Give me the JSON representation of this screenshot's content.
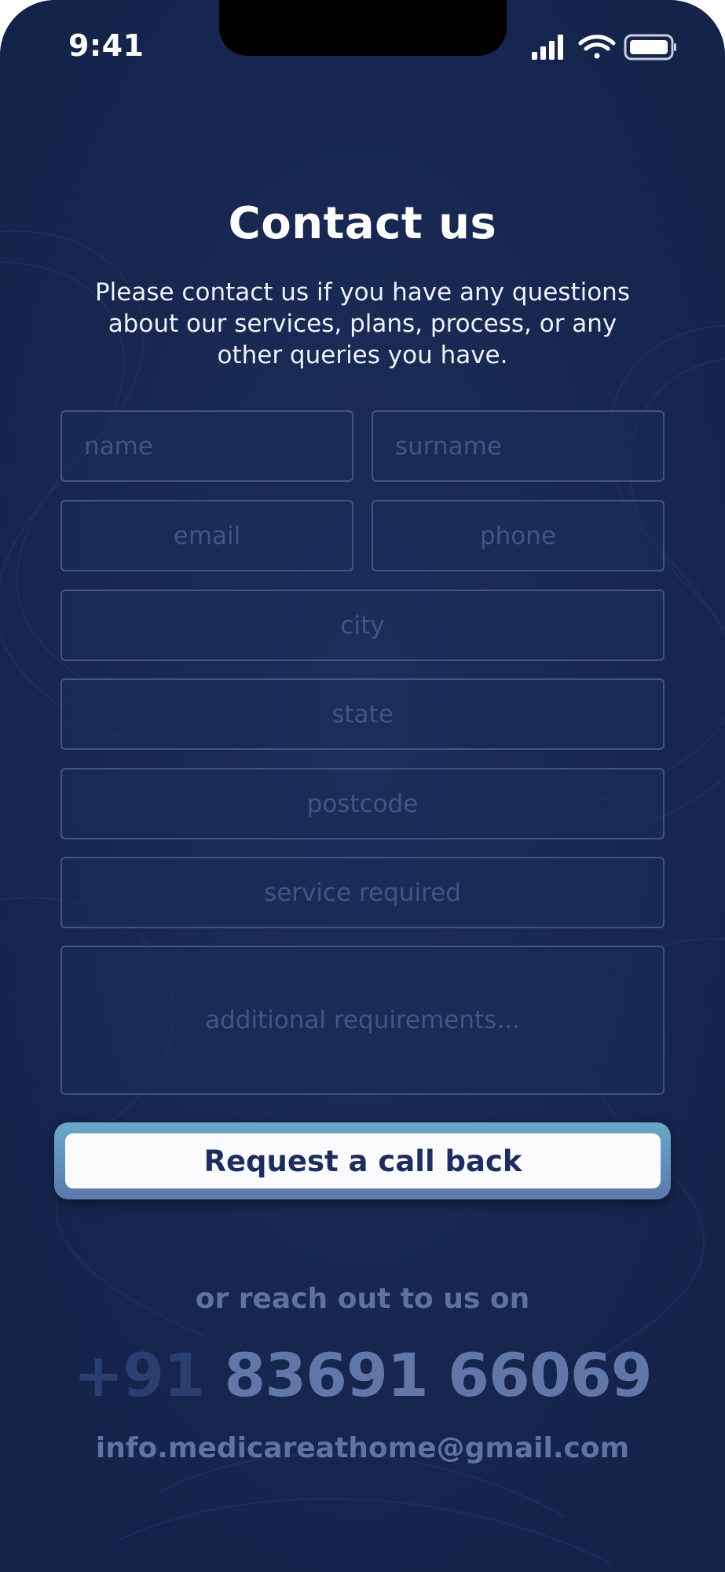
{
  "status_bar": {
    "time": "9:41"
  },
  "header": {
    "title": "Contact us",
    "subtitle": "Please contact us if you have any questions about our services, plans, process, or any other queries you have."
  },
  "form": {
    "name_placeholder": "name",
    "surname_placeholder": "surname",
    "email_placeholder": "email",
    "phone_placeholder": "phone",
    "city_placeholder": "city",
    "state_placeholder": "state",
    "postcode_placeholder": "postcode",
    "service_placeholder": "service required",
    "requirements_placeholder": "additional requirements..."
  },
  "cta": {
    "label": "Request a call back"
  },
  "footer": {
    "reach_text": "or reach out to us on",
    "phone_prefix": "+91",
    "phone_number": "83691 66069",
    "email": "info.medicareathome@gmail.com"
  },
  "colors": {
    "background": "#16264d",
    "field_text": "#3e5787",
    "button_text": "#1d2d5e"
  },
  "icons": [
    "cellular-signal-icon",
    "wifi-icon",
    "battery-icon"
  ]
}
